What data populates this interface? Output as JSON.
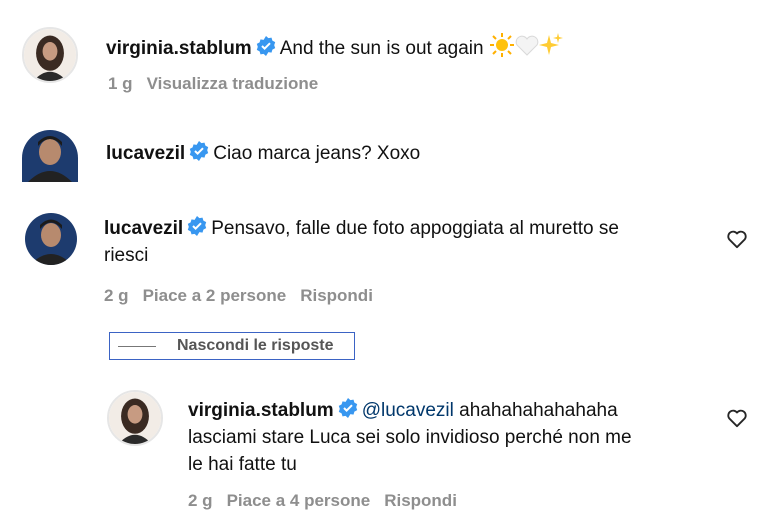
{
  "comments": [
    {
      "username": "virginia.stablum",
      "text": "And the sun is out again",
      "time": "1 g",
      "translate": "Visualizza traduzione"
    },
    {
      "username": "lucavezil",
      "text": "Ciao marca jeans? Xoxo"
    },
    {
      "username": "lucavezil",
      "text_line1": "Pensavo, falle due foto appoggiata al muretto se",
      "text_line2": "riesci",
      "time": "2 g",
      "likes": "Piace a 2 persone",
      "reply": "Rispondi"
    }
  ],
  "toggle_replies": "Nascondi le risposte",
  "reply": {
    "username": "virginia.stablum",
    "mention": "@lucavezil",
    "text_line1": "ahahahahahahaha",
    "text_line2": "lasciami stare Luca sei solo invidioso perché non me",
    "text_line3": "le hai fatte tu",
    "time": "2 g",
    "likes": "Piace a 4 persone",
    "reply_label": "Rispondi"
  },
  "colors": {
    "verified": "#3897f0",
    "meta": "#8e8e8e",
    "mention": "#00376b"
  }
}
